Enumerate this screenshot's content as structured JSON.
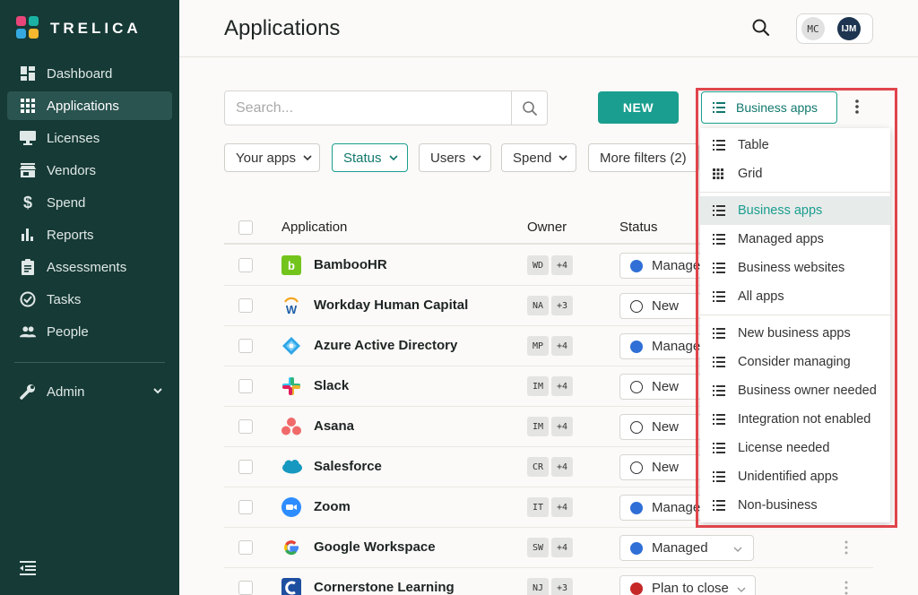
{
  "brand": {
    "name": "TRELICA"
  },
  "sidebar": {
    "items": [
      {
        "label": "Dashboard",
        "icon": "dashboard-icon"
      },
      {
        "label": "Applications",
        "icon": "grid-icon",
        "active": true
      },
      {
        "label": "Licenses",
        "icon": "monitor-icon"
      },
      {
        "label": "Vendors",
        "icon": "store-icon"
      },
      {
        "label": "Spend",
        "icon": "dollar-icon"
      },
      {
        "label": "Reports",
        "icon": "bar-chart-icon"
      },
      {
        "label": "Assessments",
        "icon": "clipboard-icon"
      },
      {
        "label": "Tasks",
        "icon": "check-circle-icon"
      },
      {
        "label": "People",
        "icon": "people-icon"
      }
    ],
    "admin_label": "Admin"
  },
  "header": {
    "title": "Applications",
    "avatars": [
      "MC",
      "IJM"
    ]
  },
  "search": {
    "placeholder": "Search..."
  },
  "toolbar": {
    "new_label": "NEW",
    "view_label": "Business apps"
  },
  "filters": [
    "Your apps",
    "Status",
    "Users",
    "Spend",
    "More filters (2)"
  ],
  "table": {
    "columns": {
      "application": "Application",
      "owner": "Owner",
      "status": "Status"
    },
    "rows": [
      {
        "name": "BambooHR",
        "owner": "WD",
        "extra": "+4",
        "status": "Managed",
        "status_color": "#2f6fd6",
        "icon": "bamboohr-icon"
      },
      {
        "name": "Workday Human Capital",
        "owner": "NA",
        "extra": "+3",
        "status": "New",
        "status_color": "",
        "icon": "workday-icon"
      },
      {
        "name": "Azure Active Directory",
        "owner": "MP",
        "extra": "+4",
        "status": "Managed",
        "status_color": "#2f6fd6",
        "icon": "azure-icon"
      },
      {
        "name": "Slack",
        "owner": "IM",
        "extra": "+4",
        "status": "New",
        "status_color": "",
        "icon": "slack-icon"
      },
      {
        "name": "Asana",
        "owner": "IM",
        "extra": "+4",
        "status": "New",
        "status_color": "",
        "icon": "asana-icon"
      },
      {
        "name": "Salesforce",
        "owner": "CR",
        "extra": "+4",
        "status": "New",
        "status_color": "",
        "icon": "salesforce-icon"
      },
      {
        "name": "Zoom",
        "owner": "IT",
        "extra": "+4",
        "status": "Managed",
        "status_color": "#2f6fd6",
        "icon": "zoom-icon"
      },
      {
        "name": "Google Workspace",
        "owner": "SW",
        "extra": "+4",
        "status": "Managed",
        "status_color": "#2f6fd6",
        "icon": "google-icon"
      },
      {
        "name": "Cornerstone Learning",
        "owner": "NJ",
        "extra": "+3",
        "status": "Plan to close",
        "status_color": "#c62828",
        "icon": "cornerstone-icon"
      }
    ]
  },
  "dropdown": {
    "layout_options": [
      {
        "label": "Table",
        "icon": "list-icon"
      },
      {
        "label": "Grid",
        "icon": "grid-icon"
      }
    ],
    "views": [
      {
        "label": "Business apps",
        "selected": true
      },
      {
        "label": "Managed apps"
      },
      {
        "label": "Business websites"
      },
      {
        "label": "All apps"
      }
    ],
    "saved_views": [
      {
        "label": "New business apps"
      },
      {
        "label": "Consider managing"
      },
      {
        "label": "Business owner needed"
      },
      {
        "label": "Integration not enabled"
      },
      {
        "label": "License needed"
      },
      {
        "label": "Unidentified apps"
      },
      {
        "label": "Non-business"
      }
    ]
  },
  "colors": {
    "sidebar": "#163a36",
    "accent": "#1a9e8f",
    "managed": "#2f6fd6",
    "plan_to_close": "#c62828",
    "highlight": "#e0454b"
  }
}
